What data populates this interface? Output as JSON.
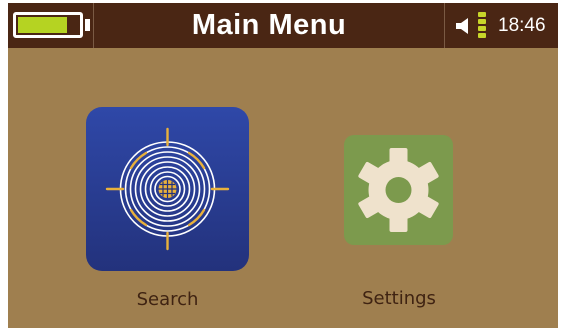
{
  "status_bar": {
    "battery_level": 0.82,
    "battery_color": "#b5d322",
    "speaker_icon": "speaker-icon",
    "signal_icon": "signal-strength-icon",
    "signal_color": "#c8d62a",
    "time": "18:46"
  },
  "header": {
    "title": "Main Menu",
    "background": "#4a2614"
  },
  "menu": {
    "items": [
      {
        "label": "Search",
        "icon": "search-target-icon",
        "tile_color": "#2a3f96",
        "accent_color": "#e9b13b"
      },
      {
        "label": "Settings",
        "icon": "gear-icon",
        "tile_color": "#7c9a4d",
        "icon_color": "#efe2cc"
      }
    ]
  },
  "theme": {
    "background": "#9f7f4f",
    "label_color": "#3f2312"
  }
}
